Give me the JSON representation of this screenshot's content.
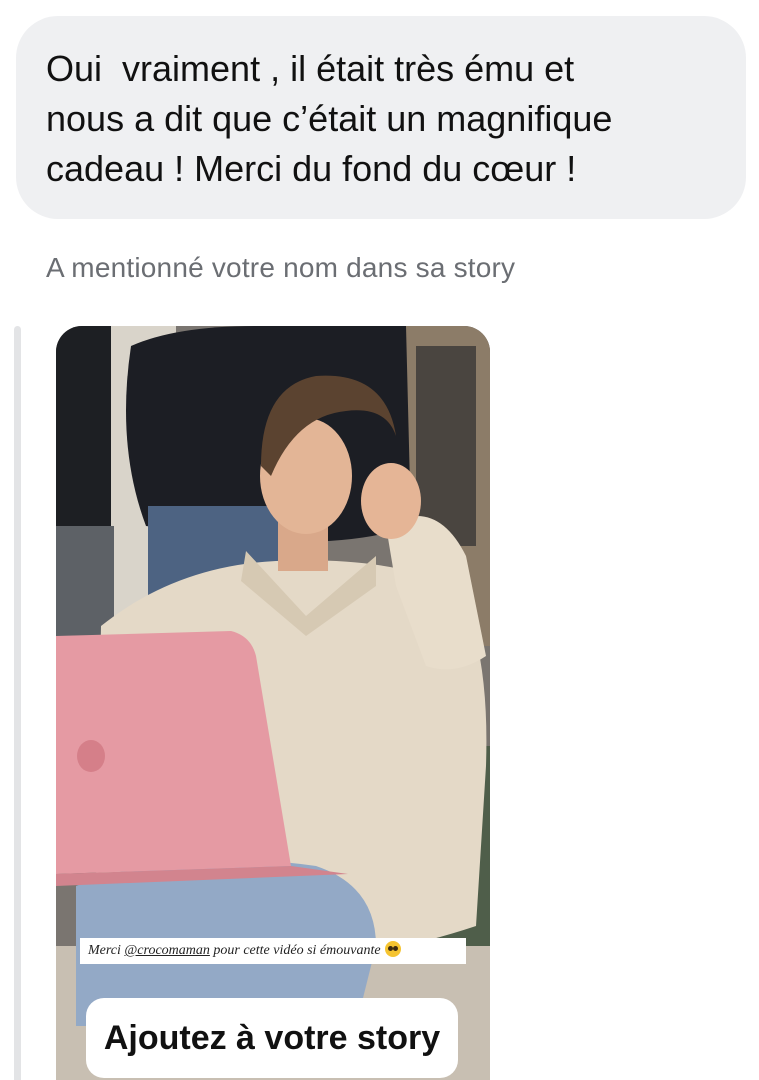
{
  "message": {
    "lines": [
      "Oui  vraiment , il était très ému et",
      "nous a dit que c’était un magnifique",
      "cadeau ! Merci du fond du cœur !"
    ]
  },
  "mention_note": "A mentionné votre nom dans sa story",
  "story": {
    "caption_prefix": "Merci ",
    "caption_handle": "@crocomaman",
    "caption_suffix": " pour cette vidéo si émouvante",
    "caption_emoji": "pleading-face-icon",
    "add_button_label": "Ajoutez à votre story"
  },
  "colors": {
    "bubble_bg": "#eff0f2",
    "note_text": "#6b6e73",
    "sweater": "#e4d9c7",
    "laptop": "#e59aa3",
    "jeans": "#93a9c6"
  }
}
